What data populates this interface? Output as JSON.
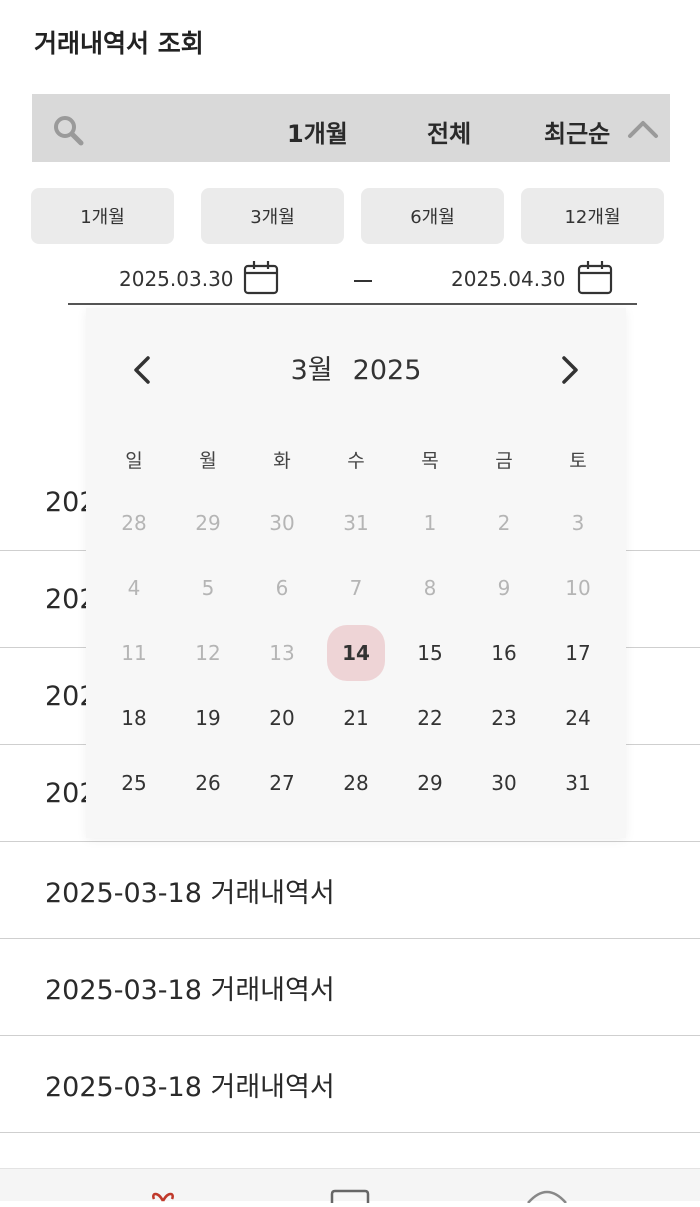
{
  "page": {
    "title": "거래내역서 조회"
  },
  "filter_bar": {
    "search_icon": "search-icon",
    "period": "1개월",
    "type": "전체",
    "sort": "최근순",
    "toggle_icon": "chevron-up-icon"
  },
  "period_buttons": [
    "1개월",
    "3개월",
    "6개월",
    "12개월"
  ],
  "date_range": {
    "start": "2025.03.30",
    "end": "2025.04.30",
    "calendar_icon": "calendar-icon"
  },
  "calendar": {
    "month": "3월",
    "year": "2025",
    "prev_icon": "chevron-left-icon",
    "next_icon": "chevron-right-icon",
    "weekdays": [
      "일",
      "월",
      "화",
      "수",
      "목",
      "금",
      "토"
    ],
    "weeks": [
      [
        "28",
        "29",
        "30",
        "31",
        "1",
        "2",
        "3"
      ],
      [
        "4",
        "5",
        "6",
        "7",
        "8",
        "9",
        "10"
      ],
      [
        "11",
        "12",
        "13",
        "14",
        "15",
        "16",
        "17"
      ],
      [
        "18",
        "19",
        "20",
        "21",
        "22",
        "23",
        "24"
      ],
      [
        "25",
        "26",
        "27",
        "28",
        "29",
        "30",
        "31"
      ]
    ],
    "selected_day": "14",
    "accent_color": "#eed4d6"
  },
  "statements": [
    "202",
    "202",
    "202",
    "202",
    "2025-03-18 거래내역서",
    "2025-03-18 거래내역서",
    "2025-03-18 거래내역서"
  ],
  "bottom_nav": {
    "icons": [
      "gift-icon",
      "document-icon",
      "profile-icon"
    ]
  }
}
